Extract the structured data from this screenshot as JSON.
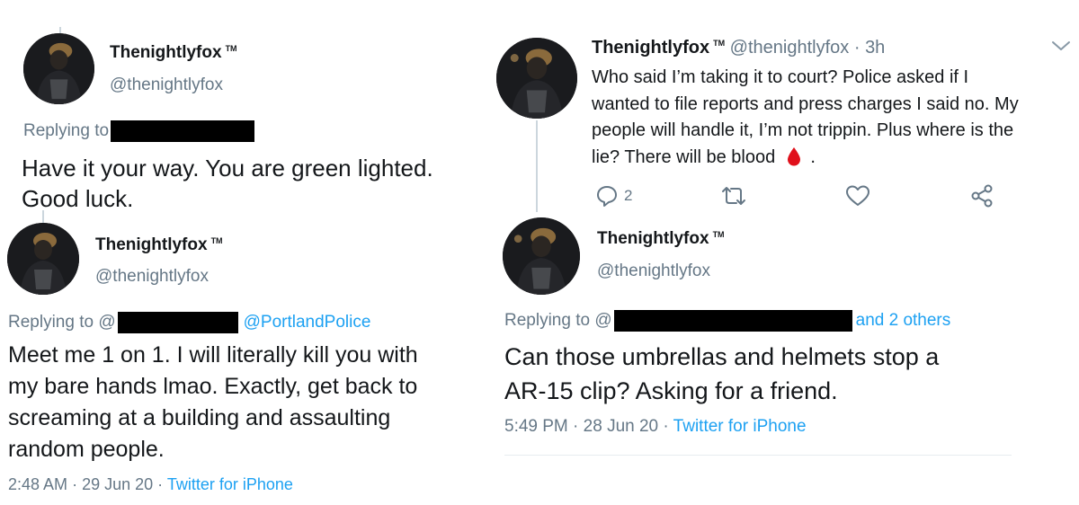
{
  "tweets": [
    {
      "name": "Thenightlyfox",
      "tm": "TM",
      "handle": "@thenightlyfox",
      "replying_to": "Replying to",
      "line1": "Have it your way. You are green lighted.",
      "line2": "Good luck."
    },
    {
      "name": "Thenightlyfox",
      "tm": "TM",
      "handle": "@thenightlyfox",
      "replying_to": "Replying to @",
      "mention": "@PortlandPolice",
      "lines": [
        "Meet me 1 on 1. I will literally kill you with",
        "my bare hands lmao. Exactly, get back to",
        "screaming at a building and assaulting",
        "random people."
      ],
      "time": "2:48 AM",
      "date": "29 Jun 20",
      "source": "Twitter for iPhone"
    },
    {
      "name": "Thenightlyfox",
      "tm": "TM",
      "handle": "@thenightlyfox",
      "age": "3h",
      "lines": [
        "Who said I’m taking it to court? Police asked if I",
        "wanted to file reports and press charges I said no. My",
        "people will handle it, I’m not trippin. Plus where is the",
        "lie? There will be blood"
      ],
      "end": ".",
      "reply_count": "2"
    },
    {
      "name": "Thenightlyfox",
      "tm": "TM",
      "handle": "@thenightlyfox",
      "replying_to": "Replying to @",
      "others": "and 2 others",
      "lines": [
        "Can those umbrellas and helmets stop a",
        "AR-15 clip? Asking for a friend."
      ],
      "time": "5:49 PM",
      "date": "28 Jun 20",
      "source": "Twitter for iPhone"
    }
  ],
  "icons": {
    "reply": "reply-icon",
    "retweet": "retweet-icon",
    "like": "heart-icon",
    "share": "share-icon",
    "caret": "chevron-down-icon",
    "blood": "blood-drop-icon"
  },
  "colors": {
    "link": "#1da1f2",
    "muted": "#657786",
    "text": "#14171a",
    "blood": "#e0101b"
  }
}
